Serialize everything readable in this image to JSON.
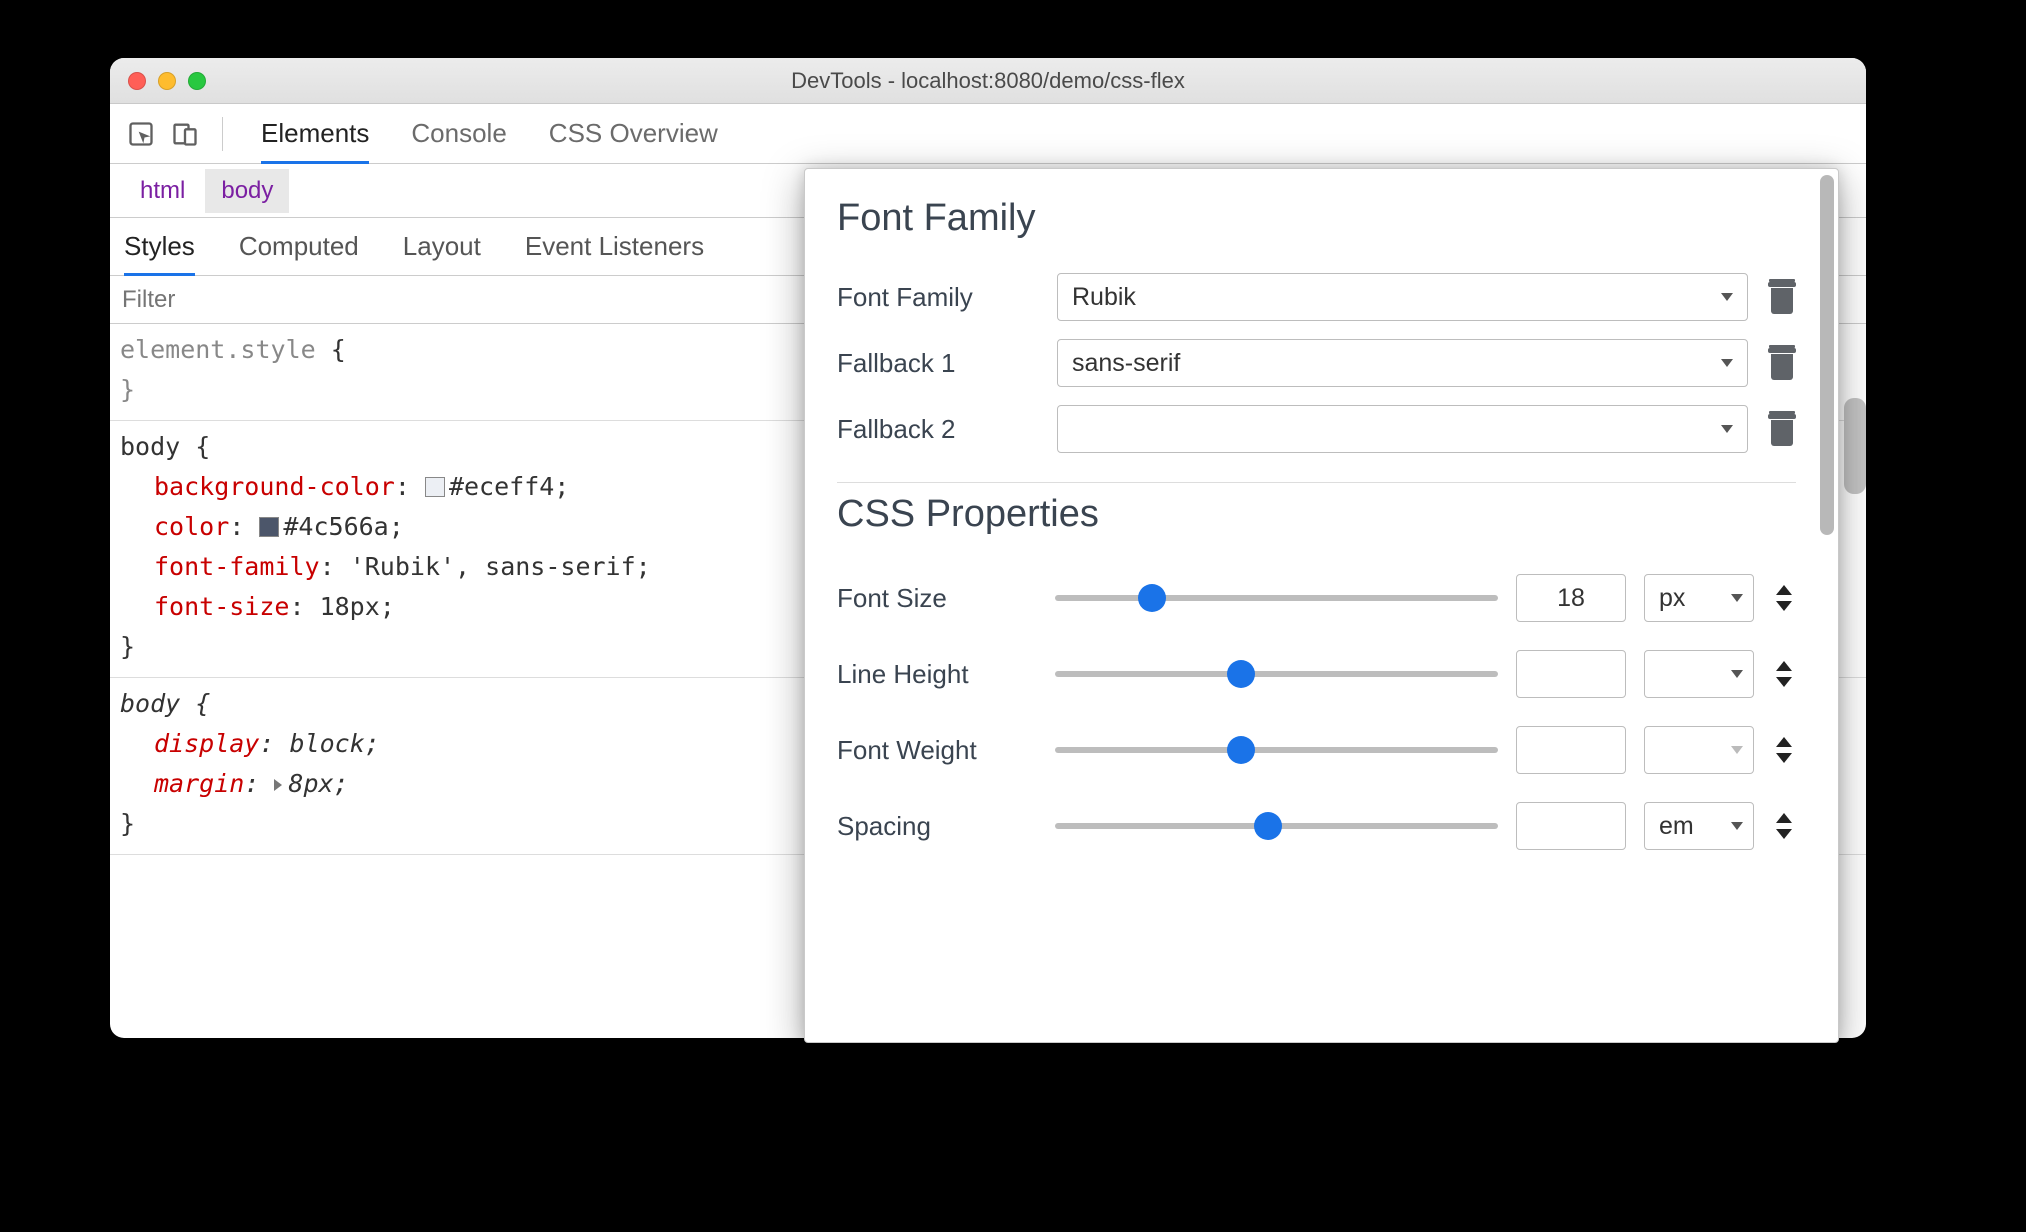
{
  "window": {
    "title": "DevTools - localhost:8080/demo/css-flex"
  },
  "toolbar": {
    "tabs": [
      "Elements",
      "Console",
      "CSS Overview"
    ],
    "active_index": 0
  },
  "breadcrumb": {
    "items": [
      "html",
      "body"
    ],
    "active_index": 1
  },
  "subtabs": {
    "items": [
      "Styles",
      "Computed",
      "Layout",
      "Event Listeners"
    ],
    "active_index": 0
  },
  "filter": {
    "placeholder": "Filter",
    "value": ""
  },
  "styles": {
    "rules": [
      {
        "selector": "element.style",
        "gray": true,
        "declarations": []
      },
      {
        "selector": "body",
        "declarations": [
          {
            "prop": "background-color",
            "swatch": "#eceff4",
            "value": "#eceff4"
          },
          {
            "prop": "color",
            "swatch": "#4c566a",
            "value": "#4c566a"
          },
          {
            "prop": "font-family",
            "value": "'Rubik', sans-serif"
          },
          {
            "prop": "font-size",
            "value": "18px"
          }
        ]
      },
      {
        "selector": "body",
        "italic": true,
        "declarations": [
          {
            "prop": "display",
            "value": "block"
          },
          {
            "prop": "margin",
            "caret": true,
            "value": "8px"
          }
        ]
      }
    ]
  },
  "fontEditor": {
    "section1_title": "Font Family",
    "family_rows": [
      {
        "label": "Font Family",
        "value": "Rubik"
      },
      {
        "label": "Fallback 1",
        "value": "sans-serif"
      },
      {
        "label": "Fallback 2",
        "value": ""
      }
    ],
    "section2_title": "CSS Properties",
    "prop_rows": [
      {
        "label": "Font Size",
        "value": "18",
        "unit": "px",
        "thumb_pct": 22
      },
      {
        "label": "Line Height",
        "value": "",
        "unit": "",
        "thumb_pct": 42
      },
      {
        "label": "Font Weight",
        "value": "",
        "unit": "",
        "thumb_pct": 42,
        "unit_muted": true
      },
      {
        "label": "Spacing",
        "value": "",
        "unit": "em",
        "thumb_pct": 48
      }
    ]
  }
}
